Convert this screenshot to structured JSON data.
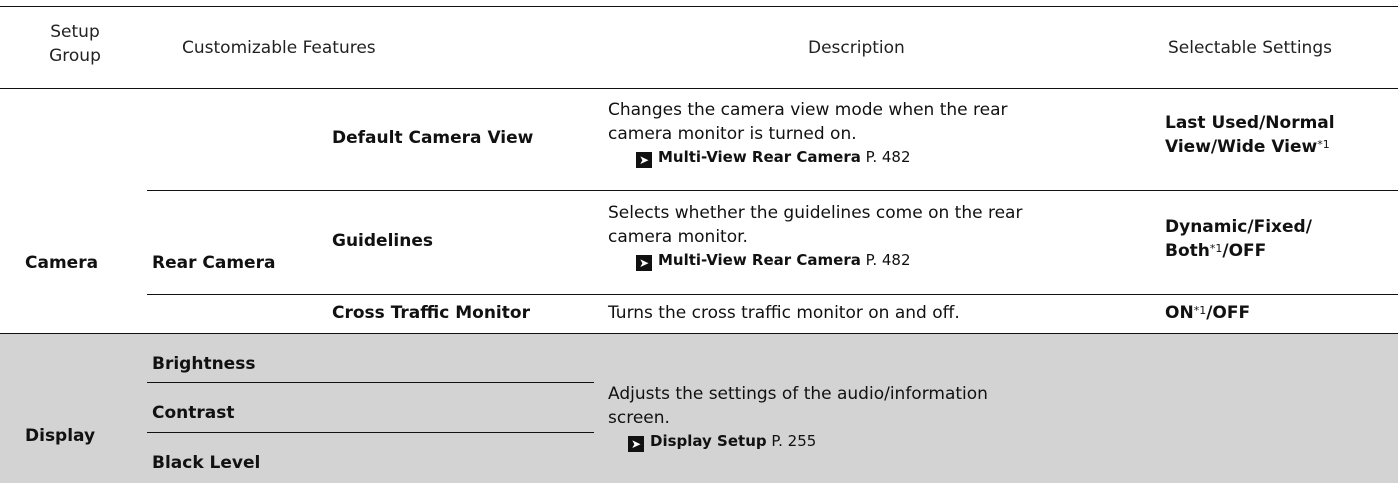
{
  "headers": {
    "setup_group": "Setup Group",
    "customizable_features": "Customizable Features",
    "description": "Description",
    "selectable_settings": "Selectable Settings"
  },
  "camera": {
    "group": "Camera",
    "subgroup": "Rear Camera",
    "rows": [
      {
        "feature": "Default Camera View",
        "desc_line1": "Changes the camera view mode when the rear",
        "desc_line2": "camera monitor is turned on.",
        "ref_link": "Multi-View Rear Camera",
        "ref_page": "P. 482",
        "setting_line1": "Last Used/Normal",
        "setting_line2": "View/Wide View",
        "setting_sup": "*1"
      },
      {
        "feature": "Guidelines",
        "desc_line1": "Selects whether the guidelines come on the rear",
        "desc_line2": "camera monitor.",
        "ref_link": "Multi-View Rear Camera",
        "ref_page": "P. 482",
        "setting_line1": "Dynamic/Fixed/",
        "setting_line2a": "Both",
        "setting_sup": "*1",
        "setting_line2b": "/OFF"
      },
      {
        "feature": "Cross Traffic Monitor",
        "desc_line1": "Turns the cross traffic monitor on and off.",
        "setting_a": "ON",
        "setting_sup": "*1",
        "setting_b": "/OFF"
      }
    ]
  },
  "display": {
    "group": "Display",
    "features": [
      "Brightness",
      "Contrast",
      "Black Level"
    ],
    "desc_line1": "Adjusts the settings of the audio/information",
    "desc_line2": "screen.",
    "ref_link": "Display Setup",
    "ref_page": "P. 255"
  },
  "icons": {
    "reference": "reference-arrow-icon"
  }
}
